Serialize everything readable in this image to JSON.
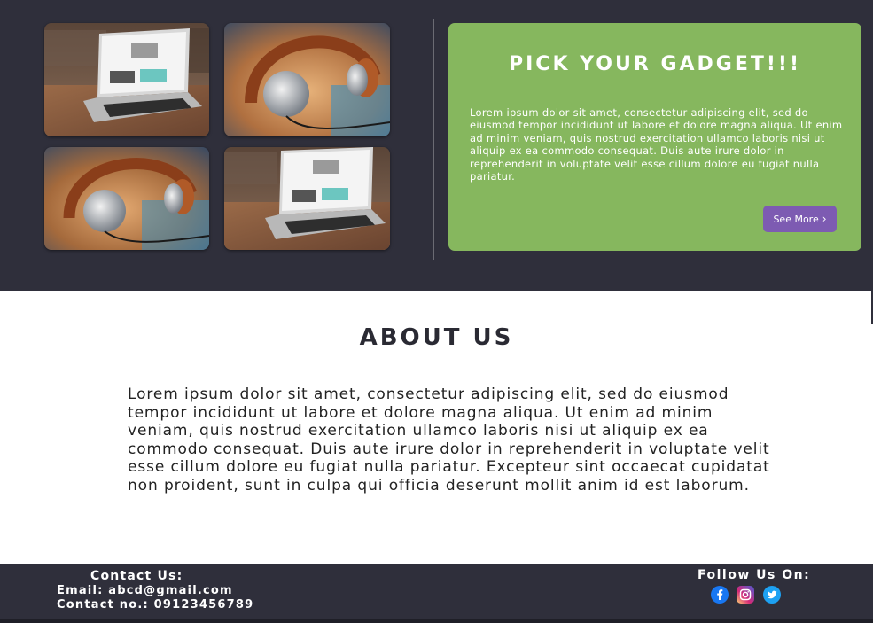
{
  "gallery": {
    "images": [
      {
        "name": "laptop-photo"
      },
      {
        "name": "headphones-photo"
      },
      {
        "name": "headphones-photo"
      },
      {
        "name": "laptop-photo"
      }
    ]
  },
  "promo": {
    "title": "PICK YOUR GADGET!!!",
    "body": "Lorem ipsum dolor sit amet, consectetur adipiscing elit, sed do eiusmod tempor incididunt ut labore et dolore magna aliqua. Ut enim ad minim veniam, quis nostrud exercitation ullamco laboris nisi ut aliquip ex ea commodo consequat. Duis aute irure dolor in reprehenderit in voluptate velit esse cillum dolore eu fugiat nulla pariatur.",
    "button_label": "See More",
    "button_icon": "chevron-right-icon",
    "colors": {
      "card": "#86b75e",
      "button": "#7d5bb2",
      "background": "#2f2f3b"
    }
  },
  "about": {
    "title": "ABOUT US",
    "body": "Lorem ipsum dolor sit amet, consectetur adipiscing elit, sed do eiusmod tempor incididunt ut labore et dolore magna aliqua. Ut enim ad minim veniam, quis nostrud exercitation ullamco laboris nisi ut aliquip ex ea commodo consequat. Duis aute irure dolor in reprehenderit in voluptate velit esse cillum dolore eu fugiat nulla pariatur. Excepteur sint occaecat cupidatat non proident, sunt in culpa qui officia deserunt mollit anim id est laborum."
  },
  "footer": {
    "contact_title": "Contact Us:",
    "email": "Email: abcd@gmail.com",
    "phone": "Contact no.: 09123456789",
    "follow_title": "Follow Us On:",
    "social": [
      "facebook-icon",
      "instagram-icon",
      "twitter-icon"
    ]
  }
}
